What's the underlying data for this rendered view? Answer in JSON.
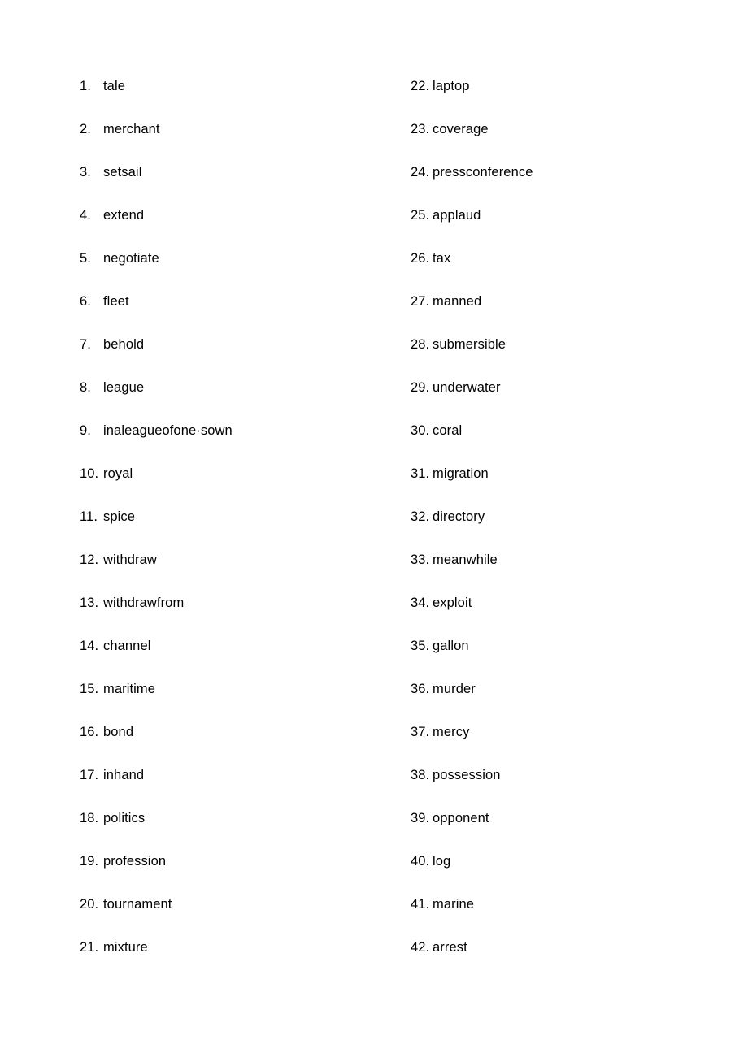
{
  "document": {
    "background_color": "#ffffff",
    "text_color": "#000000"
  },
  "vocabulary_list": {
    "left_column": [
      {
        "number": "1.",
        "word": "tale"
      },
      {
        "number": "2.",
        "word": "merchant"
      },
      {
        "number": "3.",
        "word": "setsail"
      },
      {
        "number": "4.",
        "word": "extend"
      },
      {
        "number": "5.",
        "word": "negotiate"
      },
      {
        "number": "6.",
        "word": "fleet"
      },
      {
        "number": "7.",
        "word": "behold"
      },
      {
        "number": "8.",
        "word": "league"
      },
      {
        "number": "9.",
        "word": "inaleagueofone·sown"
      },
      {
        "number": "10.",
        "word": "royal"
      },
      {
        "number": "11.",
        "word": "spice"
      },
      {
        "number": "12.",
        "word": "withdraw"
      },
      {
        "number": "13.",
        "word": "withdrawfrom"
      },
      {
        "number": "14.",
        "word": "channel"
      },
      {
        "number": "15.",
        "word": "maritime"
      },
      {
        "number": "16.",
        "word": "bond"
      },
      {
        "number": "17.",
        "word": "inhand"
      },
      {
        "number": "18.",
        "word": "politics"
      },
      {
        "number": "19.",
        "word": "profession"
      },
      {
        "number": "20.",
        "word": "tournament"
      },
      {
        "number": "21.",
        "word": "mixture"
      }
    ],
    "right_column": [
      {
        "number": "22.",
        "word": "laptop"
      },
      {
        "number": "23.",
        "word": "coverage"
      },
      {
        "number": "24.",
        "word": "pressconference"
      },
      {
        "number": "25.",
        "word": "applaud"
      },
      {
        "number": "26.",
        "word": "tax"
      },
      {
        "number": "27.",
        "word": "manned"
      },
      {
        "number": "28.",
        "word": "submersible"
      },
      {
        "number": "29.",
        "word": "underwater"
      },
      {
        "number": "30.",
        "word": "coral"
      },
      {
        "number": "31.",
        "word": "migration"
      },
      {
        "number": "32.",
        "word": "directory"
      },
      {
        "number": "33.",
        "word": "meanwhile"
      },
      {
        "number": "34.",
        "word": "exploit"
      },
      {
        "number": "35.",
        "word": "gallon"
      },
      {
        "number": "36.",
        "word": "murder"
      },
      {
        "number": "37.",
        "word": "mercy"
      },
      {
        "number": "38.",
        "word": "possession"
      },
      {
        "number": "39.",
        "word": "opponent"
      },
      {
        "number": "40.",
        "word": "log"
      },
      {
        "number": "41.",
        "word": "marine"
      },
      {
        "number": "42.",
        "word": "arrest"
      }
    ]
  }
}
